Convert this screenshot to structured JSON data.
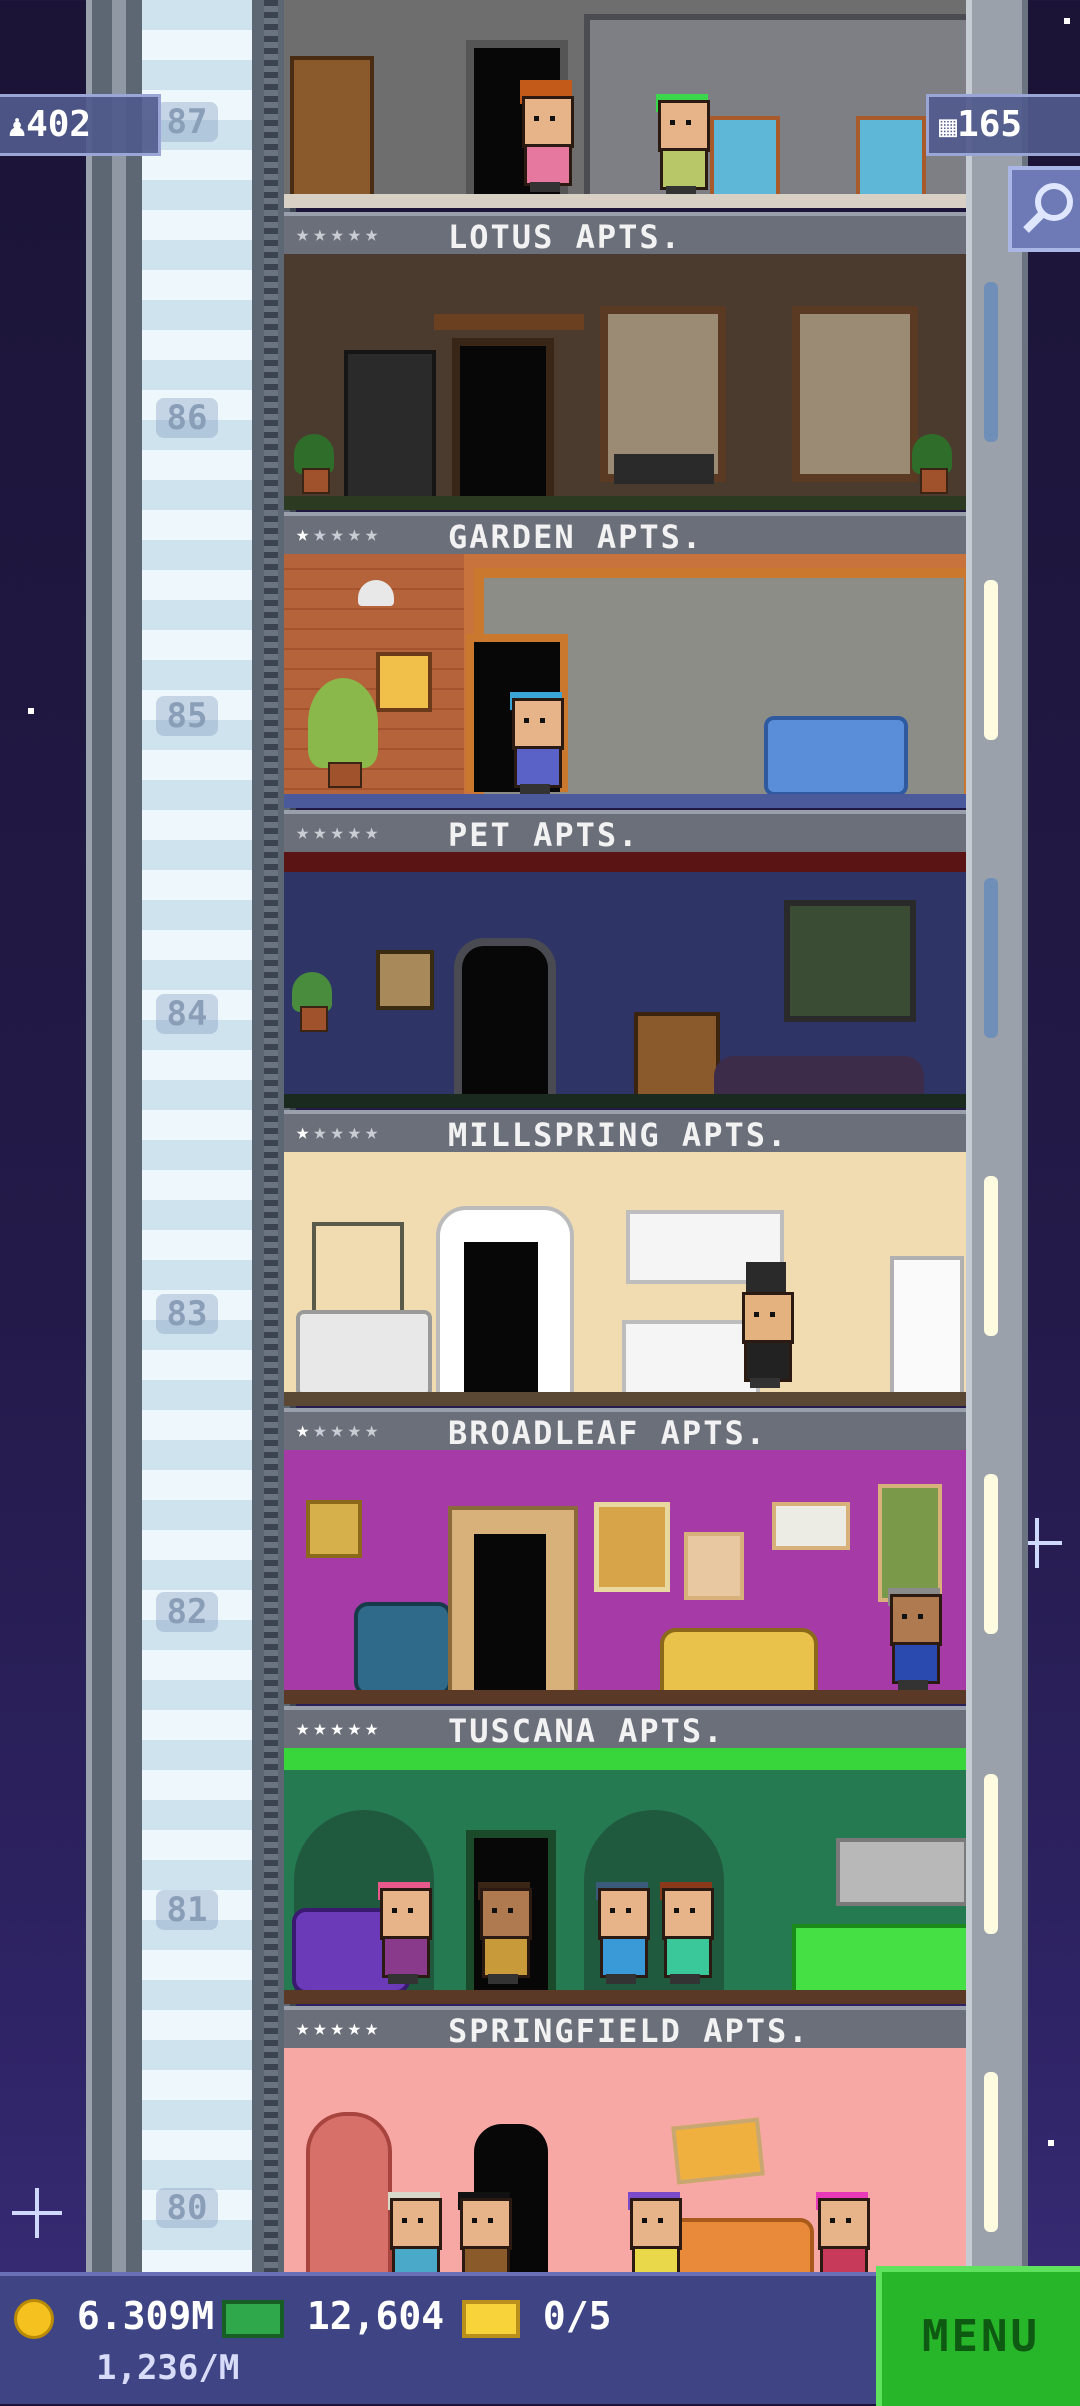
{
  "hud": {
    "population": "402",
    "floors_count": "165",
    "people_icon": "people-icon",
    "floors_icon": "building-icon",
    "search_icon": "magnifier-icon"
  },
  "floors": [
    {
      "number": "87",
      "name": "",
      "kind": "apartment"
    },
    {
      "number": "86",
      "name": "LOTUS APTS."
    },
    {
      "number": "85",
      "name": "GARDEN APTS."
    },
    {
      "number": "84",
      "name": "PET APTS."
    },
    {
      "number": "83",
      "name": "MILLSPRING APTS."
    },
    {
      "number": "82",
      "name": "BROADLEAF APTS."
    },
    {
      "number": "81",
      "name": "TUSCANA APTS."
    },
    {
      "number": "80",
      "name": "SPRINGFIELD APTS."
    }
  ],
  "labels": [
    {
      "name": "LOTUS APTS.",
      "stars_filled": 0
    },
    {
      "name": "GARDEN APTS.",
      "stars_filled": 1
    },
    {
      "name": "PET APTS.",
      "stars_filled": 0
    },
    {
      "name": "MILLSPRING APTS.",
      "stars_filled": 1
    },
    {
      "name": "BROADLEAF APTS.",
      "stars_filled": 1
    },
    {
      "name": "TUSCANA APTS.",
      "stars_filled": 5
    },
    {
      "name": "SPRINGFIELD APTS.",
      "stars_filled": 5
    }
  ],
  "bottom": {
    "coins": "6.309M",
    "coins_rate": "1,236/M",
    "bux": "12,604",
    "tickets": "0/5",
    "menu_label": "MENU"
  },
  "colors": {
    "menu_green": "#27b52a",
    "hud_bar": "#3f4584"
  }
}
